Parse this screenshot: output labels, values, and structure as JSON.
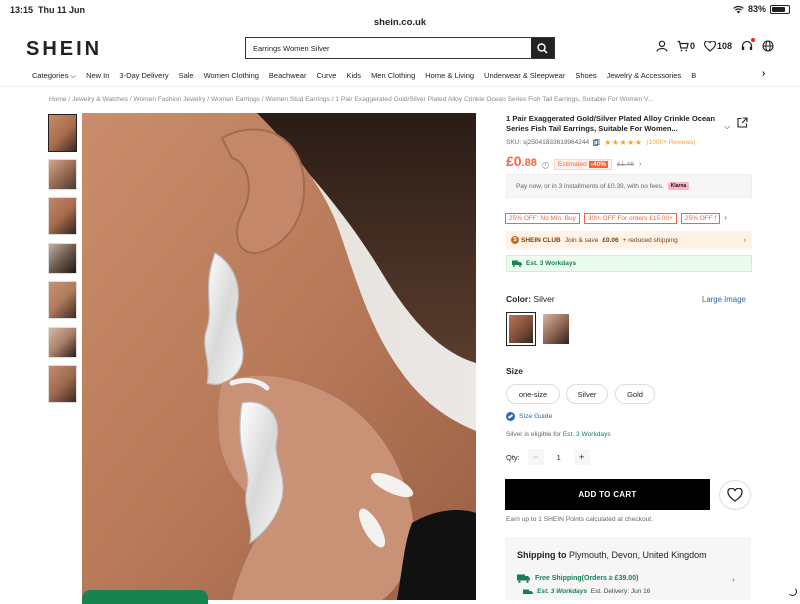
{
  "status_bar": {
    "time": "13:15",
    "date": "Thu 11 Jun",
    "battery": "83%",
    "battery_level": 0.83
  },
  "browser": {
    "url": "shein.co.uk"
  },
  "header": {
    "logo": "SHEIN",
    "search_value": "Earrings Women Silver",
    "cart_count": "0",
    "wishlist_count": "108"
  },
  "nav": {
    "items": [
      "Categories",
      "New In",
      "3-Day Delivery",
      "Sale",
      "Women Clothing",
      "Beachwear",
      "Curve",
      "Kids",
      "Men Clothing",
      "Home & Living",
      "Underwear & Sleepwear",
      "Shoes",
      "Jewelry & Accessories",
      "B"
    ]
  },
  "breadcrumb": "Home / Jewelry & Watches / Women Fashion Jewelry / Women Earrings / Women Stud Earrings / 1 Pair Exaggerated Gold/Silver Plated Alloy Crinkle Ocean Series Fish Tail Earrings, Suitable For Women V...",
  "product": {
    "title": "1 Pair Exaggerated Gold/Silver Plated Alloy Crinkle Ocean Series Fish Tail Earrings, Suitable For Women...",
    "sku": "SKU: sj25041833619964244",
    "rating_stars": "★★★★★",
    "reviews": "(1000+ Reviews)",
    "price_currency": "£",
    "price_main": "0",
    "price_decimal": ".88",
    "estimated_label": "Estimated",
    "estimated_pct": "-40%",
    "original_price": "£1.46",
    "installments": "Pay now, or in 3 installments of £0.39, with no fees.",
    "klarna": "Klarna"
  },
  "promos": [
    "25% OFF: No Min. Buy",
    "30% OFF For orders £15.00+",
    "25% OFF f"
  ],
  "club": {
    "name": "SHEIN CLUB",
    "text": "Join & save",
    "amount": "£0.06",
    "suffix": "+ reduced shipping"
  },
  "workdays": "Est. 3 Workdays",
  "color": {
    "label": "Color:",
    "value": "Silver",
    "large_image": "Large Image"
  },
  "size": {
    "label": "Size",
    "options": [
      "one-size",
      "Silver",
      "Gold"
    ]
  },
  "size_guide": "Size Guide",
  "eligible": {
    "prefix": "Silver is eligible for",
    "highlight": "Est. 3 Workdays"
  },
  "qty": {
    "label": "Qty:",
    "value": "1",
    "minus": "−",
    "plus": "+"
  },
  "add_to_cart": "ADD TO CART",
  "points": "Earn up to 1 SHEIN Points calculated at checkout.",
  "shipping": {
    "title": "Shipping to",
    "location": "Plymouth, Devon, United Kingdom",
    "free": "Free Shipping(Orders ≥ £39.00)",
    "est": "Est. 3 Workdays",
    "delivery": "Est. Delivery: Jun 16"
  }
}
